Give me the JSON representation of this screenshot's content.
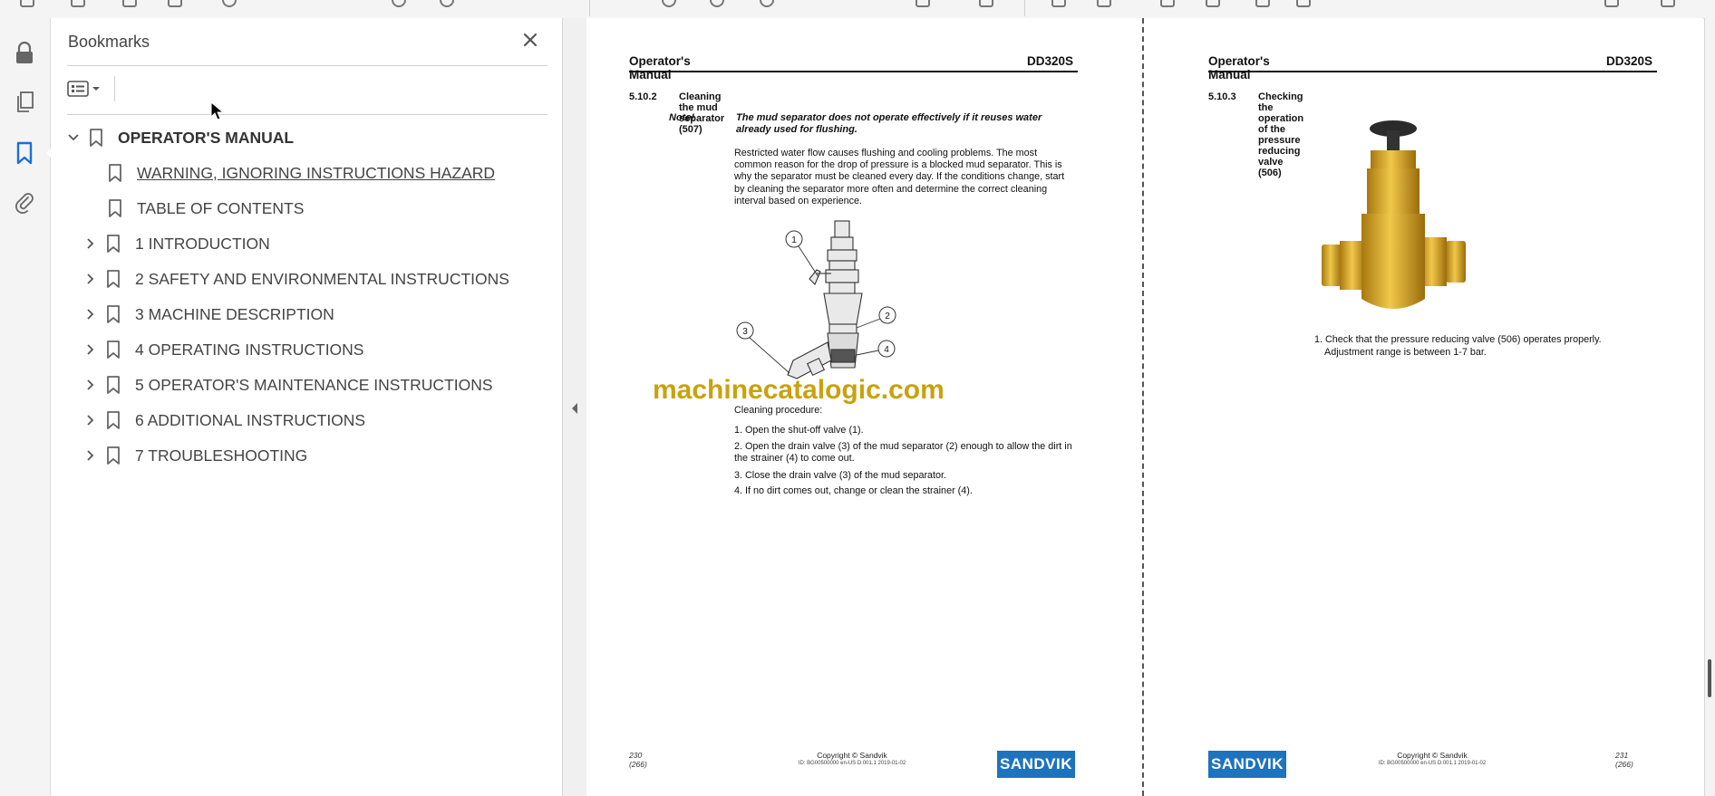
{
  "sidebar": {
    "title": "Bookmarks",
    "items": [
      {
        "label": "OPERATOR'S MANUAL"
      },
      {
        "label": "WARNING, IGNORING INSTRUCTIONS HAZARD"
      },
      {
        "label": "TABLE OF CONTENTS"
      },
      {
        "label": "1 INTRODUCTION"
      },
      {
        "label": "2 SAFETY AND ENVIRONMENTAL INSTRUCTIONS"
      },
      {
        "label": "3 MACHINE DESCRIPTION"
      },
      {
        "label": "4 OPERATING INSTRUCTIONS"
      },
      {
        "label": "5 OPERATOR'S MAINTENANCE INSTRUCTIONS"
      },
      {
        "label": "6 ADDITIONAL INSTRUCTIONS"
      },
      {
        "label": "7 TROUBLESHOOTING"
      }
    ]
  },
  "left_page": {
    "header_left": "Operator's Manual",
    "header_right": "DD320S",
    "section_number": "5.10.2",
    "section_title": "Cleaning the mud separator (507)",
    "note_label": "Note!",
    "note_text": "The mud separator does not operate effectively if it reuses water already used for flushing.",
    "paragraph": "Restricted water flow causes flushing and cooling problems. The most common reason for the drop of pressure is a blocked mud separator. This is why the separator must be cleaned every day. If the conditions change, start by cleaning the separator more often and determine the correct cleaning interval based on experience.",
    "callouts": [
      "1",
      "2",
      "3",
      "4"
    ],
    "procedure_title": "Cleaning procedure:",
    "steps": [
      "1. Open the shut-off valve (1).",
      "2. Open the drain valve (3) of the mud separator (2) enough to allow the dirt in the strainer (4) to come out.",
      "3. Close the drain valve (3) of the mud separator.",
      "4. If no dirt comes out, change or clean the strainer (4)."
    ],
    "page_number": "230 (266)",
    "copyright": "Copyright © Sandvik",
    "id_line": "ID: BG00500000 en-US D.001.1 2019-01-02",
    "logo": "SANDVIK"
  },
  "right_page": {
    "header_left": "Operator's Manual",
    "header_right": "DD320S",
    "section_number": "5.10.3",
    "section_title": "Checking the operation of the pressure reducing valve (506)",
    "steps": [
      "1. Check that the pressure reducing valve (506) operates properly.",
      "Adjustment range is between 1-7 bar."
    ],
    "page_number": "231 (266)",
    "copyright": "Copyright © Sandvik",
    "id_line": "ID: BG00500000 en-US D.001.1 2019-01-02",
    "logo": "SANDVIK"
  },
  "watermark": "machinecatalogic.com",
  "colors": {
    "accent": "#1a6fd6",
    "sandvik_blue": "#1e73be",
    "watermark": "#c9a20d"
  }
}
